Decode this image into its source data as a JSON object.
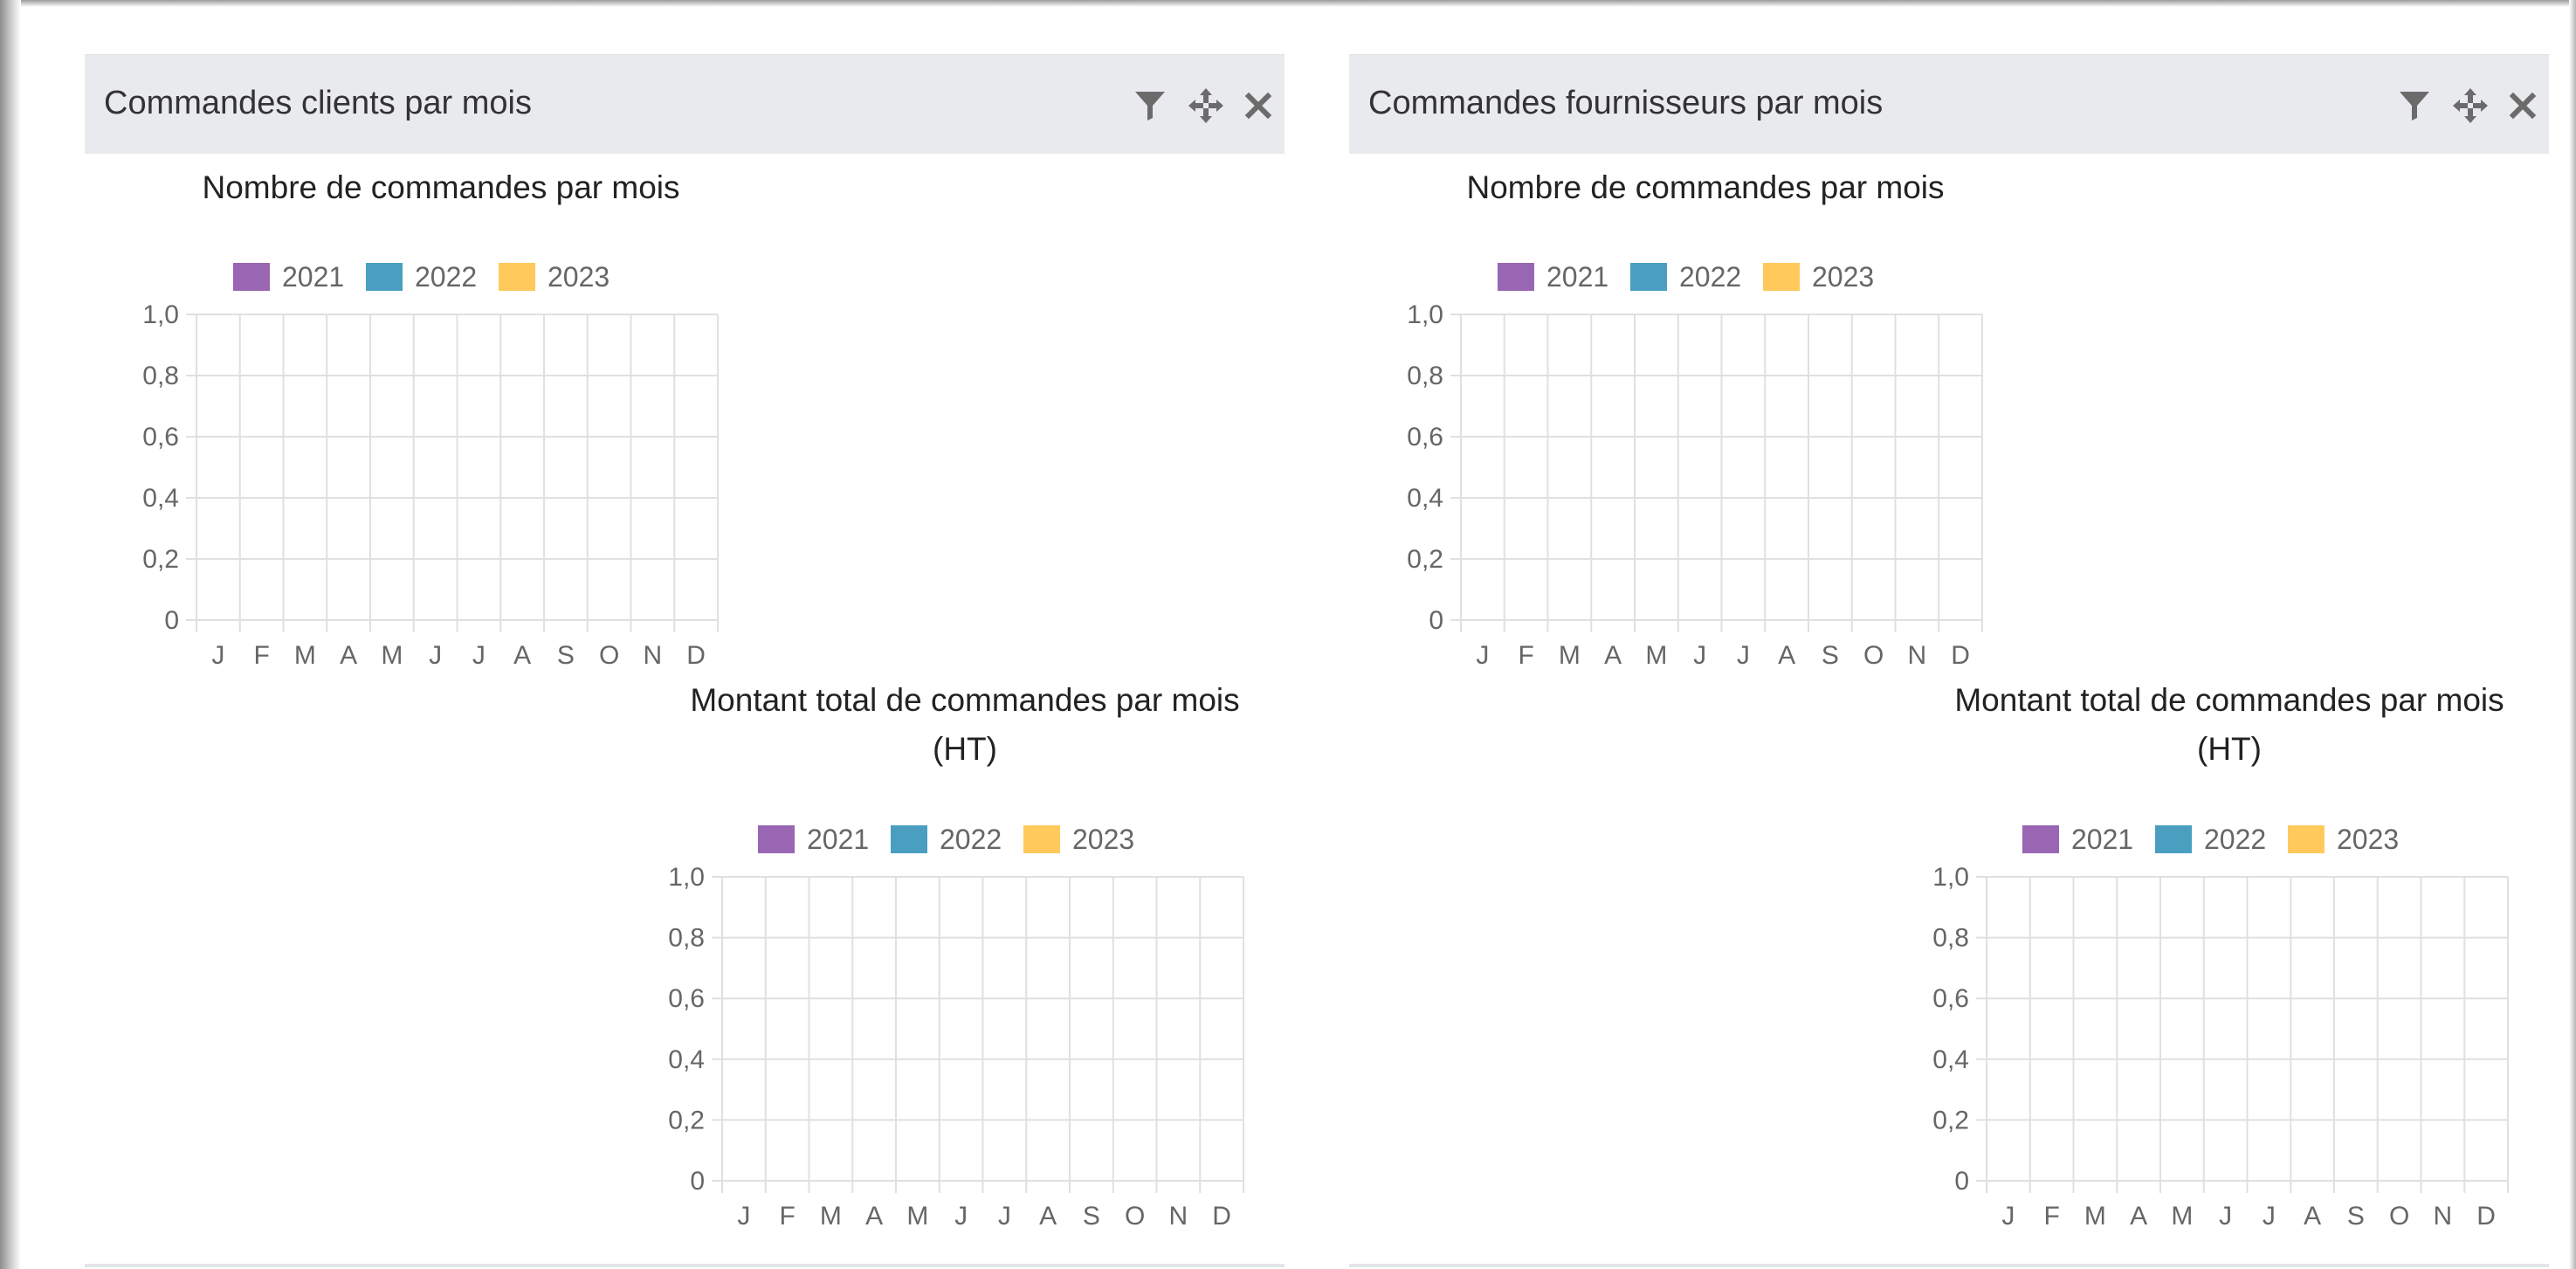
{
  "panels": [
    {
      "title": "Commandes clients par mois",
      "tools": {
        "filter_icon": "filter-icon",
        "move_icon": "move-icon",
        "close_icon": "close-icon"
      }
    },
    {
      "title": "Commandes fournisseurs par mois",
      "tools": {
        "filter_icon": "filter-icon",
        "move_icon": "move-icon",
        "close_icon": "close-icon"
      }
    }
  ],
  "colors": {
    "header_bg": "#e9eaed",
    "grid": "#e0e0e0",
    "tick_text": "#666666",
    "icon": "#6b6b6b"
  },
  "chart_data": [
    {
      "panel": "Commandes clients par mois",
      "type": "bar",
      "title": [
        "Nombre de commandes par mois"
      ],
      "categories": [
        "J",
        "F",
        "M",
        "A",
        "M",
        "J",
        "J",
        "A",
        "S",
        "O",
        "N",
        "D"
      ],
      "series": [
        {
          "name": "2021",
          "color": "#9966b3",
          "values": []
        },
        {
          "name": "2022",
          "color": "#4a9fc1",
          "values": []
        },
        {
          "name": "2023",
          "color": "#ffc95c",
          "values": []
        }
      ],
      "yticks": [
        "0",
        "0,2",
        "0,4",
        "0,6",
        "0,8",
        "1,0"
      ],
      "ylim": [
        0,
        1
      ],
      "grid": true,
      "legend": "top"
    },
    {
      "panel": "Commandes clients par mois",
      "type": "bar",
      "title": [
        "Montant total de commandes par mois",
        "(HT)"
      ],
      "categories": [
        "J",
        "F",
        "M",
        "A",
        "M",
        "J",
        "J",
        "A",
        "S",
        "O",
        "N",
        "D"
      ],
      "series": [
        {
          "name": "2021",
          "color": "#9966b3",
          "values": []
        },
        {
          "name": "2022",
          "color": "#4a9fc1",
          "values": []
        },
        {
          "name": "2023",
          "color": "#ffc95c",
          "values": []
        }
      ],
      "yticks": [
        "0",
        "0,2",
        "0,4",
        "0,6",
        "0,8",
        "1,0"
      ],
      "ylim": [
        0,
        1
      ],
      "grid": true,
      "legend": "top"
    },
    {
      "panel": "Commandes fournisseurs par mois",
      "type": "bar",
      "title": [
        "Nombre de commandes par mois"
      ],
      "categories": [
        "J",
        "F",
        "M",
        "A",
        "M",
        "J",
        "J",
        "A",
        "S",
        "O",
        "N",
        "D"
      ],
      "series": [
        {
          "name": "2021",
          "color": "#9966b3",
          "values": []
        },
        {
          "name": "2022",
          "color": "#4a9fc1",
          "values": []
        },
        {
          "name": "2023",
          "color": "#ffc95c",
          "values": []
        }
      ],
      "yticks": [
        "0",
        "0,2",
        "0,4",
        "0,6",
        "0,8",
        "1,0"
      ],
      "ylim": [
        0,
        1
      ],
      "grid": true,
      "legend": "top"
    },
    {
      "panel": "Commandes fournisseurs par mois",
      "type": "bar",
      "title": [
        "Montant total de commandes par mois",
        "(HT)"
      ],
      "categories": [
        "J",
        "F",
        "M",
        "A",
        "M",
        "J",
        "J",
        "A",
        "S",
        "O",
        "N",
        "D"
      ],
      "series": [
        {
          "name": "2021",
          "color": "#9966b3",
          "values": []
        },
        {
          "name": "2022",
          "color": "#4a9fc1",
          "values": []
        },
        {
          "name": "2023",
          "color": "#ffc95c",
          "values": []
        }
      ],
      "yticks": [
        "0",
        "0,2",
        "0,4",
        "0,6",
        "0,8",
        "1,0"
      ],
      "ylim": [
        0,
        1
      ],
      "grid": true,
      "legend": "top"
    }
  ]
}
